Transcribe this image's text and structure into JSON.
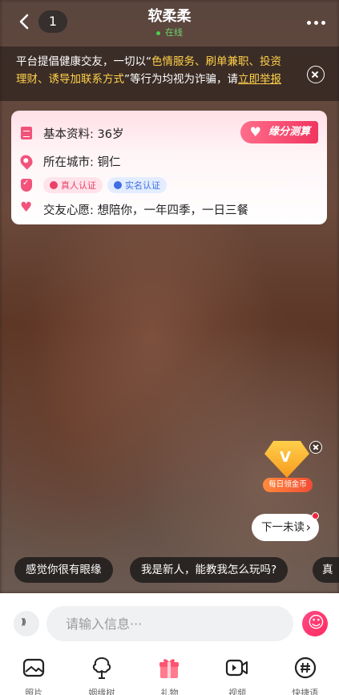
{
  "header": {
    "title": "软柔柔",
    "status": "在线",
    "unread_count": "1"
  },
  "notice": {
    "text_1": "平台提倡健康交友，一切以“",
    "text_hl": "色情服务、刷单兼职、投资理财、诱导加联系方式",
    "text_2": "”等行为均视为诈骗，请",
    "link": "立即举报"
  },
  "profile": {
    "basic_info": "基本资料: 36岁",
    "city": "所在城市:  铜仁",
    "badge_real": "真人认证",
    "badge_name": "实名认证",
    "wish": "交友心愿:  想陪你，一年四季，一日三餐",
    "fate_button": "缘分测算"
  },
  "promo": {
    "label": "每日领金币",
    "gem_letter": "V"
  },
  "next_unread": {
    "label": "下一未读",
    "chevron": "›"
  },
  "quick_replies": [
    "感觉你很有眼缘",
    "我是新人，能教我怎么玩吗?",
    "真"
  ],
  "composer": {
    "placeholder": "请输入信息···"
  },
  "toolbar": {
    "items": [
      {
        "label": "照片",
        "icon": "photo-icon"
      },
      {
        "label": "姻缘树",
        "icon": "tree-icon"
      },
      {
        "label": "礼物",
        "icon": "gift-icon"
      },
      {
        "label": "视频",
        "icon": "video-icon"
      },
      {
        "label": "快捷语",
        "icon": "hashtag-icon"
      }
    ]
  },
  "colors": {
    "accent": "#f2537b",
    "online": "#4cd04c",
    "notice_highlight": "#ffd24a"
  }
}
